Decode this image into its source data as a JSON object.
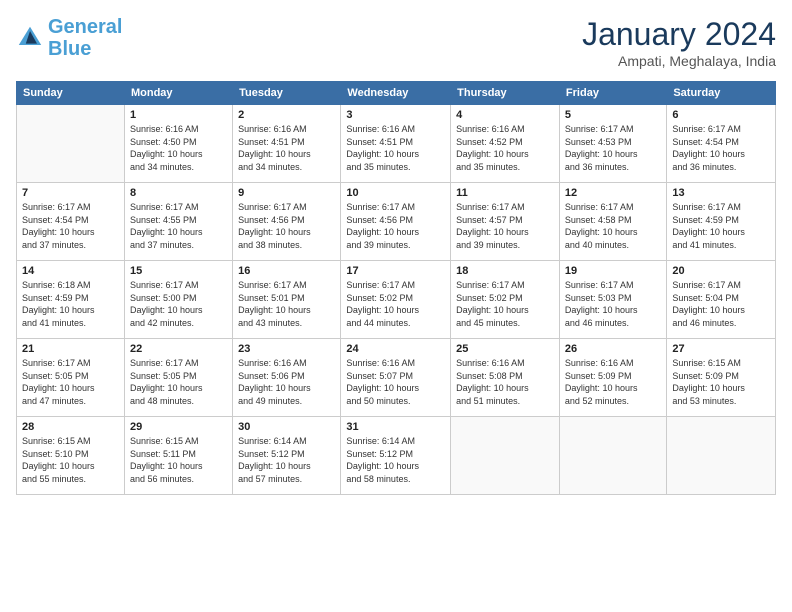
{
  "header": {
    "logo_line1": "General",
    "logo_line2": "Blue",
    "month_year": "January 2024",
    "location": "Ampati, Meghalaya, India"
  },
  "days_of_week": [
    "Sunday",
    "Monday",
    "Tuesday",
    "Wednesday",
    "Thursday",
    "Friday",
    "Saturday"
  ],
  "weeks": [
    [
      {
        "day": "",
        "info": ""
      },
      {
        "day": "1",
        "info": "Sunrise: 6:16 AM\nSunset: 4:50 PM\nDaylight: 10 hours\nand 34 minutes."
      },
      {
        "day": "2",
        "info": "Sunrise: 6:16 AM\nSunset: 4:51 PM\nDaylight: 10 hours\nand 34 minutes."
      },
      {
        "day": "3",
        "info": "Sunrise: 6:16 AM\nSunset: 4:51 PM\nDaylight: 10 hours\nand 35 minutes."
      },
      {
        "day": "4",
        "info": "Sunrise: 6:16 AM\nSunset: 4:52 PM\nDaylight: 10 hours\nand 35 minutes."
      },
      {
        "day": "5",
        "info": "Sunrise: 6:17 AM\nSunset: 4:53 PM\nDaylight: 10 hours\nand 36 minutes."
      },
      {
        "day": "6",
        "info": "Sunrise: 6:17 AM\nSunset: 4:54 PM\nDaylight: 10 hours\nand 36 minutes."
      }
    ],
    [
      {
        "day": "7",
        "info": "Sunrise: 6:17 AM\nSunset: 4:54 PM\nDaylight: 10 hours\nand 37 minutes."
      },
      {
        "day": "8",
        "info": "Sunrise: 6:17 AM\nSunset: 4:55 PM\nDaylight: 10 hours\nand 37 minutes."
      },
      {
        "day": "9",
        "info": "Sunrise: 6:17 AM\nSunset: 4:56 PM\nDaylight: 10 hours\nand 38 minutes."
      },
      {
        "day": "10",
        "info": "Sunrise: 6:17 AM\nSunset: 4:56 PM\nDaylight: 10 hours\nand 39 minutes."
      },
      {
        "day": "11",
        "info": "Sunrise: 6:17 AM\nSunset: 4:57 PM\nDaylight: 10 hours\nand 39 minutes."
      },
      {
        "day": "12",
        "info": "Sunrise: 6:17 AM\nSunset: 4:58 PM\nDaylight: 10 hours\nand 40 minutes."
      },
      {
        "day": "13",
        "info": "Sunrise: 6:17 AM\nSunset: 4:59 PM\nDaylight: 10 hours\nand 41 minutes."
      }
    ],
    [
      {
        "day": "14",
        "info": "Sunrise: 6:18 AM\nSunset: 4:59 PM\nDaylight: 10 hours\nand 41 minutes."
      },
      {
        "day": "15",
        "info": "Sunrise: 6:17 AM\nSunset: 5:00 PM\nDaylight: 10 hours\nand 42 minutes."
      },
      {
        "day": "16",
        "info": "Sunrise: 6:17 AM\nSunset: 5:01 PM\nDaylight: 10 hours\nand 43 minutes."
      },
      {
        "day": "17",
        "info": "Sunrise: 6:17 AM\nSunset: 5:02 PM\nDaylight: 10 hours\nand 44 minutes."
      },
      {
        "day": "18",
        "info": "Sunrise: 6:17 AM\nSunset: 5:02 PM\nDaylight: 10 hours\nand 45 minutes."
      },
      {
        "day": "19",
        "info": "Sunrise: 6:17 AM\nSunset: 5:03 PM\nDaylight: 10 hours\nand 46 minutes."
      },
      {
        "day": "20",
        "info": "Sunrise: 6:17 AM\nSunset: 5:04 PM\nDaylight: 10 hours\nand 46 minutes."
      }
    ],
    [
      {
        "day": "21",
        "info": "Sunrise: 6:17 AM\nSunset: 5:05 PM\nDaylight: 10 hours\nand 47 minutes."
      },
      {
        "day": "22",
        "info": "Sunrise: 6:17 AM\nSunset: 5:05 PM\nDaylight: 10 hours\nand 48 minutes."
      },
      {
        "day": "23",
        "info": "Sunrise: 6:16 AM\nSunset: 5:06 PM\nDaylight: 10 hours\nand 49 minutes."
      },
      {
        "day": "24",
        "info": "Sunrise: 6:16 AM\nSunset: 5:07 PM\nDaylight: 10 hours\nand 50 minutes."
      },
      {
        "day": "25",
        "info": "Sunrise: 6:16 AM\nSunset: 5:08 PM\nDaylight: 10 hours\nand 51 minutes."
      },
      {
        "day": "26",
        "info": "Sunrise: 6:16 AM\nSunset: 5:09 PM\nDaylight: 10 hours\nand 52 minutes."
      },
      {
        "day": "27",
        "info": "Sunrise: 6:15 AM\nSunset: 5:09 PM\nDaylight: 10 hours\nand 53 minutes."
      }
    ],
    [
      {
        "day": "28",
        "info": "Sunrise: 6:15 AM\nSunset: 5:10 PM\nDaylight: 10 hours\nand 55 minutes."
      },
      {
        "day": "29",
        "info": "Sunrise: 6:15 AM\nSunset: 5:11 PM\nDaylight: 10 hours\nand 56 minutes."
      },
      {
        "day": "30",
        "info": "Sunrise: 6:14 AM\nSunset: 5:12 PM\nDaylight: 10 hours\nand 57 minutes."
      },
      {
        "day": "31",
        "info": "Sunrise: 6:14 AM\nSunset: 5:12 PM\nDaylight: 10 hours\nand 58 minutes."
      },
      {
        "day": "",
        "info": ""
      },
      {
        "day": "",
        "info": ""
      },
      {
        "day": "",
        "info": ""
      }
    ]
  ]
}
